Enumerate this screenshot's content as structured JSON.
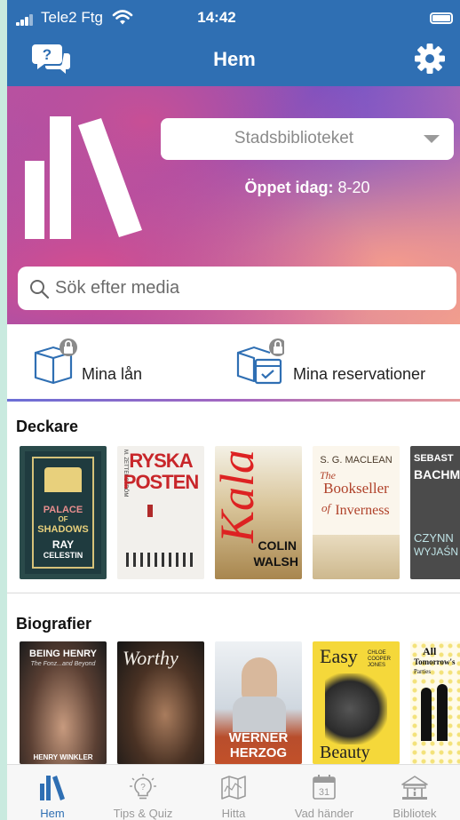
{
  "status": {
    "carrier": "Tele2 Ftg",
    "time": "14:42"
  },
  "header": {
    "title": "Hem",
    "help_icon": "chat-help-icon",
    "settings_icon": "gear-icon"
  },
  "hero": {
    "library_select": "Stadsbiblioteket",
    "open_label": "Öppet idag:",
    "open_hours": "8-20",
    "search_placeholder": "Sök efter media"
  },
  "loans": {
    "my_loans": "Mina lån",
    "my_reservations": "Mina reservationer"
  },
  "sections": [
    {
      "title": "Deckare",
      "books": [
        {
          "lines": [
            "PALACE",
            "OF",
            "SHADOWS",
            "RAY",
            "CELESTIN"
          ]
        },
        {
          "lines": [
            "M. ZETTERSTRÖM",
            "RYSKA",
            "POSTEN"
          ]
        },
        {
          "lines": [
            "Kala",
            "COLIN",
            "WALSH"
          ]
        },
        {
          "lines": [
            "S. G. MACLEAN",
            "The",
            "Bookseller",
            "of",
            "Inverness"
          ]
        },
        {
          "lines": [
            "SEBAST",
            "BACHM",
            "CZYNN",
            "WYJAŚN"
          ]
        }
      ]
    },
    {
      "title": "Biografier",
      "books": [
        {
          "lines": [
            "BEING HENRY",
            "The Fonz...and Beyond",
            "HENRY WINKLER"
          ]
        },
        {
          "lines": [
            "Worthy"
          ]
        },
        {
          "lines": [
            "WERNER",
            "HERZOG"
          ]
        },
        {
          "lines": [
            "Easy",
            "CHLOE COOPER JONES",
            "Beauty"
          ]
        },
        {
          "lines": [
            "All",
            "Tomorrow's",
            "Parties"
          ]
        }
      ]
    }
  ],
  "tabs": [
    {
      "label": "Hem",
      "icon": "library-books-icon",
      "active": true
    },
    {
      "label": "Tips & Quiz",
      "icon": "lightbulb-question-icon",
      "active": false
    },
    {
      "label": "Hitta",
      "icon": "map-icon",
      "active": false
    },
    {
      "label": "Vad händer",
      "icon": "calendar-icon",
      "active": false
    },
    {
      "label": "Bibliotek",
      "icon": "library-building-icon",
      "active": false
    }
  ],
  "colors": {
    "brand": "#2f6fb3",
    "tab_inactive": "#9a9a9a"
  },
  "calendar_day": "31"
}
